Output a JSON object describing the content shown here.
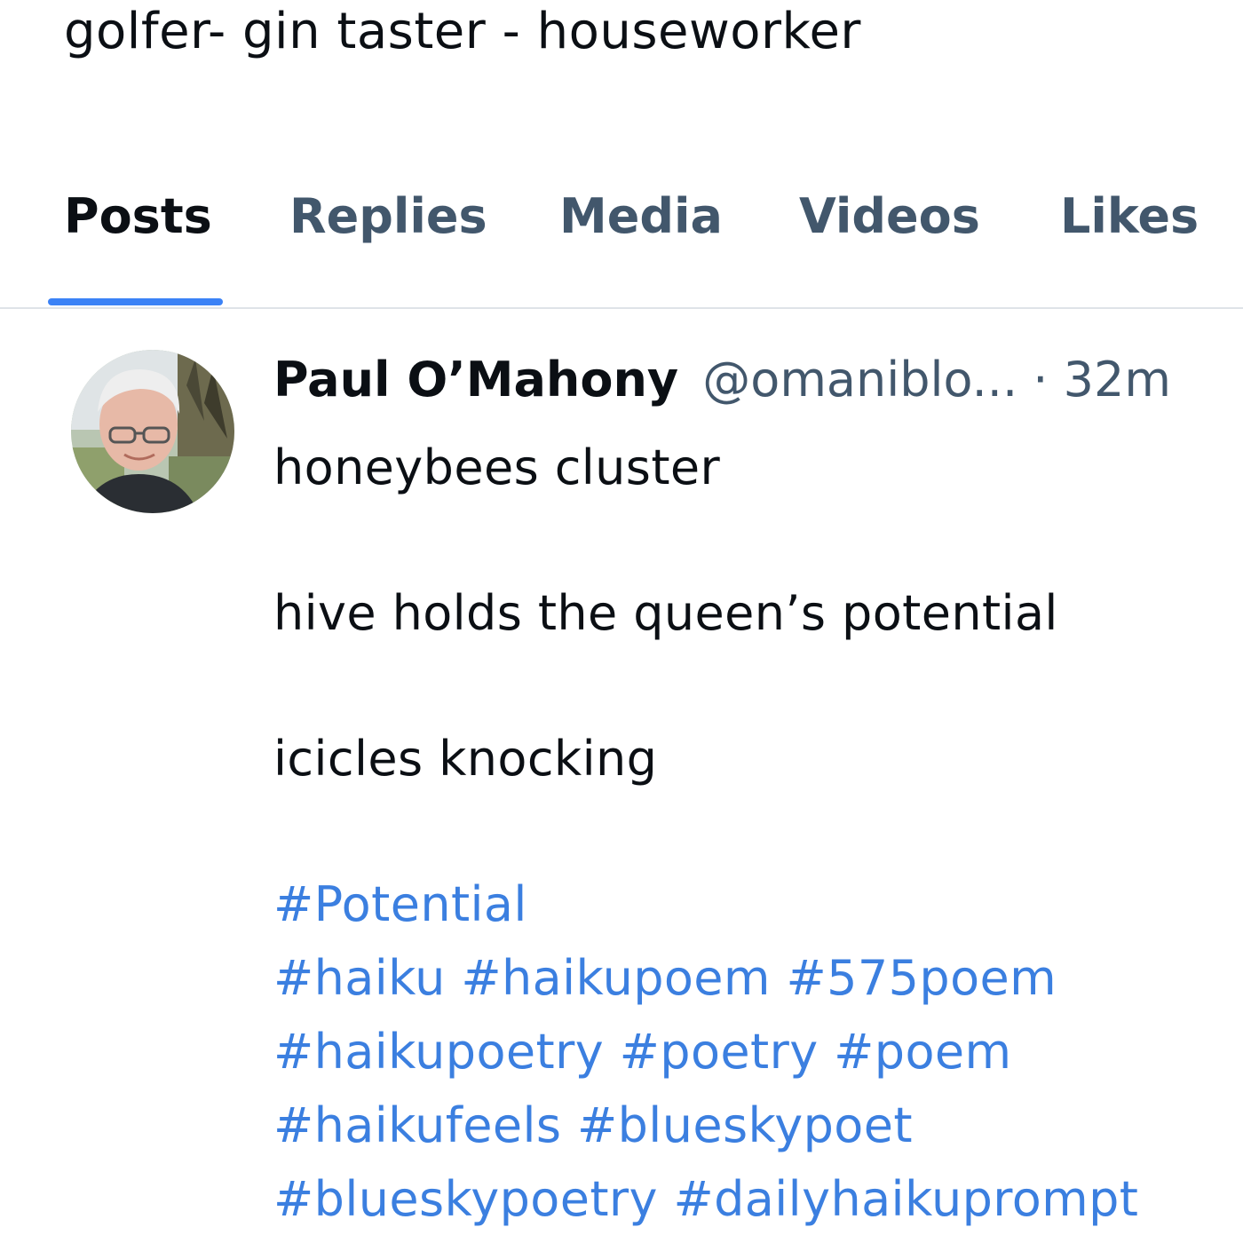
{
  "profile": {
    "bio": "golfer- gin taster - houseworker"
  },
  "tabs": [
    {
      "label": "Posts",
      "active": true
    },
    {
      "label": "Replies",
      "active": false
    },
    {
      "label": "Media",
      "active": false
    },
    {
      "label": "Videos",
      "active": false
    },
    {
      "label": "Likes",
      "active": false
    }
  ],
  "post": {
    "author_name": "Paul O’Mahony",
    "author_handle": "@omaniblo...",
    "separator": "·",
    "time": "32m",
    "lines": [
      "honeybees cluster",
      "hive holds the queen’s potential",
      "icicles knocking"
    ],
    "hashtag_lines": [
      [
        "#Potential"
      ],
      [
        "#haiku",
        "#haikupoem",
        "#575poem"
      ],
      [
        "#haikupoetry",
        "#poetry",
        "#poem"
      ],
      [
        "#haikufeels",
        "#blueskypoet"
      ],
      [
        "#blueskypoetry",
        "#dailyhaikuprompt"
      ]
    ]
  },
  "colors": {
    "accent": "#3b82f6",
    "link": "#3b7fe0",
    "muted_text": "#42576c",
    "divider": "#dfe3e8"
  },
  "icons": {
    "avatar": "avatar-photo"
  }
}
